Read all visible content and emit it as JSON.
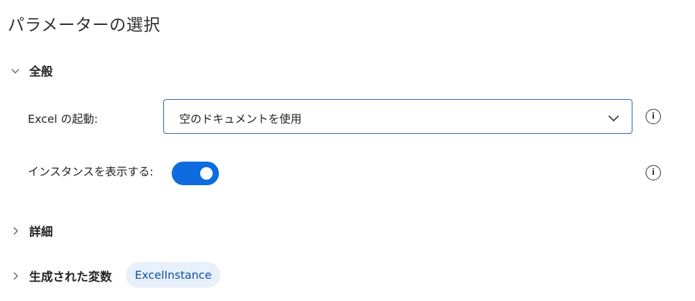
{
  "panel": {
    "title": "パラメーターの選択"
  },
  "sections": {
    "general": {
      "label": "全般",
      "expanded": true
    },
    "details": {
      "label": "詳細",
      "expanded": false
    },
    "generated_variables": {
      "label": "生成された変数",
      "expanded": false,
      "variable": "ExcelInstance"
    }
  },
  "fields": {
    "launch_excel": {
      "label": "Excel の起動:",
      "value": "空のドキュメントを使用"
    },
    "show_instance": {
      "label": "インスタンスを表示する:",
      "on": true
    }
  },
  "colors": {
    "accent": "#0f6cdf",
    "dropdown_border": "#2b5fb6",
    "chip_background": "#e8f1fb",
    "chip_text": "#0f4fa8"
  },
  "icons": {
    "info": "info-icon",
    "expand": "chevron-down-icon",
    "collapse": "chevron-right-icon"
  }
}
